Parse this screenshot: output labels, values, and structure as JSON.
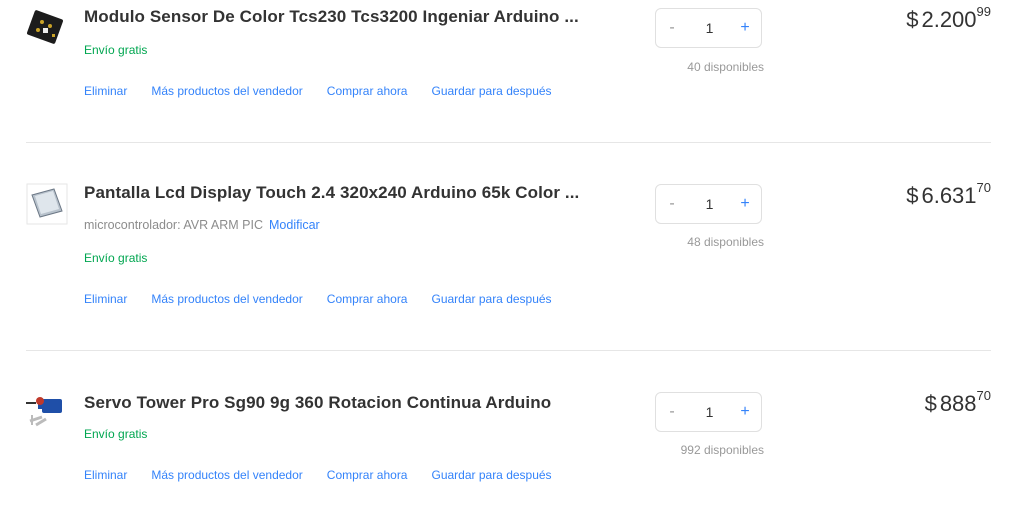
{
  "items": [
    {
      "title": "Modulo Sensor De Color Tcs230 Tcs3200 Ingeniar Arduino ...",
      "image": "sensor-board-icon",
      "shipping": "Envío gratis",
      "actions": [
        "Eliminar",
        "Más productos del vendedor",
        "Comprar ahora",
        "Guardar para después"
      ],
      "quantity": "1",
      "minus": "-",
      "plus": "+",
      "stock": "40 disponibles",
      "currency": "$",
      "price_int": "2.200",
      "price_cents": "99"
    },
    {
      "title": "Pantalla Lcd Display Touch 2.4 320x240 Arduino 65k Color ...",
      "image": "lcd-display-icon",
      "variant": "microcontrolador: AVR ARM PIC",
      "variant_action": "Modificar",
      "shipping": "Envío gratis",
      "actions": [
        "Eliminar",
        "Más productos del vendedor",
        "Comprar ahora",
        "Guardar para después"
      ],
      "quantity": "1",
      "minus": "-",
      "plus": "+",
      "stock": "48 disponibles",
      "currency": "$",
      "price_int": "6.631",
      "price_cents": "70"
    },
    {
      "title": "Servo Tower Pro Sg90 9g 360 Rotacion Continua Arduino",
      "image": "servo-motor-icon",
      "shipping": "Envío gratis",
      "actions": [
        "Eliminar",
        "Más productos del vendedor",
        "Comprar ahora",
        "Guardar para después"
      ],
      "quantity": "1",
      "minus": "-",
      "plus": "+",
      "stock": "992 disponibles",
      "currency": "$",
      "price_int": "888",
      "price_cents": "70"
    }
  ]
}
